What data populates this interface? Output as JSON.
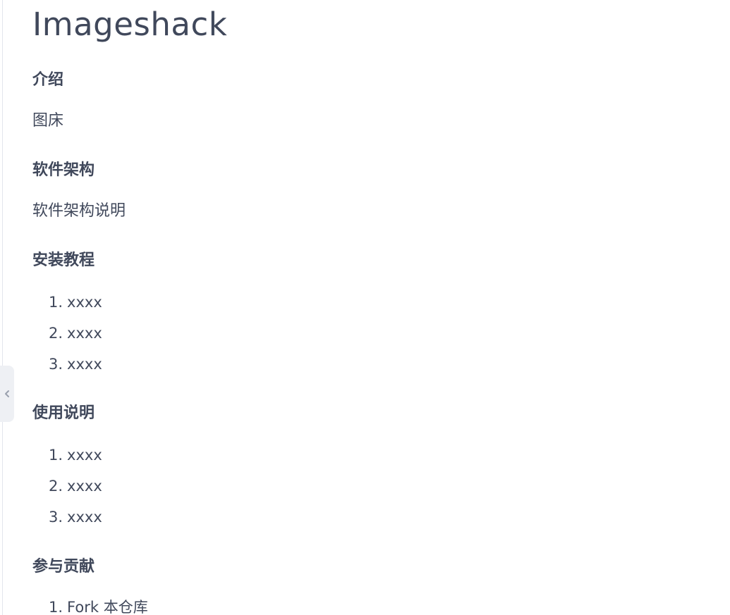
{
  "title": "Imageshack",
  "sections": [
    {
      "heading": "介绍",
      "paragraph": "图床"
    },
    {
      "heading": "软件架构",
      "paragraph": "软件架构说明"
    },
    {
      "heading": "安装教程",
      "items": [
        "xxxx",
        "xxxx",
        "xxxx"
      ]
    },
    {
      "heading": "使用说明",
      "items": [
        "xxxx",
        "xxxx",
        "xxxx"
      ]
    },
    {
      "heading": "参与贡献",
      "items": [
        "Fork 本仓库"
      ]
    }
  ],
  "collapse_toggle": {
    "icon": "chevron-left-icon"
  },
  "colors": {
    "text": "#40485b",
    "tab_bg": "#eef0f4",
    "rule": "#e3e6ec"
  }
}
